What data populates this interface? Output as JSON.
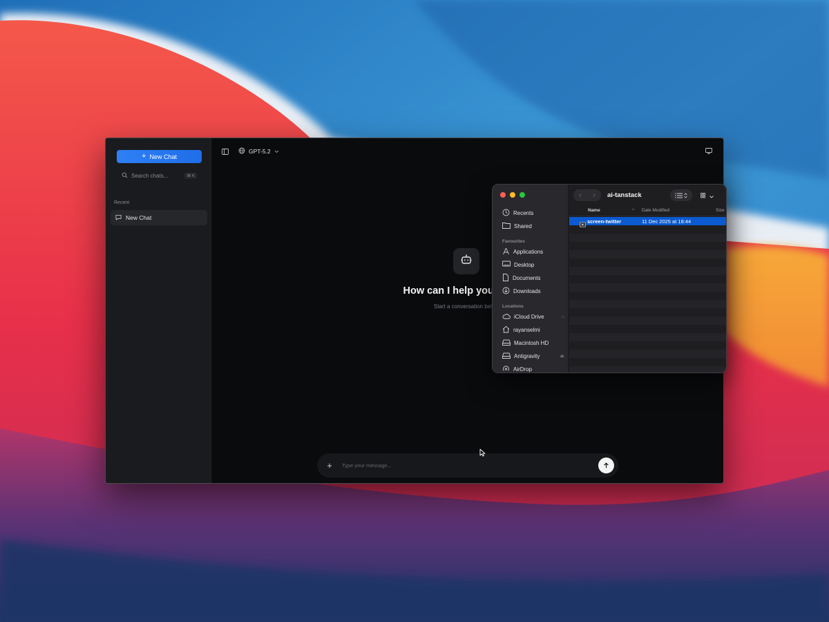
{
  "colors": {
    "accent": "#1f6ee8",
    "window_bg": "#0a0b0d",
    "sidebar_bg": "#1a1b1e",
    "selection": "#0b5acf"
  },
  "chat_app": {
    "sidebar": {
      "new_chat_label": "New Chat",
      "search_placeholder": "Search chats...",
      "search_shortcut": "⌘ K",
      "recent_label": "Recent",
      "history": [
        {
          "label": "New Chat",
          "icon": "chat-bubble-icon"
        }
      ]
    },
    "topbar": {
      "model": "GPT-5.2",
      "model_icon": "globe-icon"
    },
    "welcome": {
      "icon": "bot-icon",
      "title": "How can I help you today?",
      "subtitle": "Start a conversation below"
    },
    "composer": {
      "placeholder": "Type your message...",
      "attach_icon": "plus-icon",
      "send_icon": "arrow-up-icon"
    }
  },
  "finder": {
    "title": "ai-tanstack",
    "sidebar": {
      "top": [
        {
          "label": "Recents",
          "icon": "clock-icon"
        },
        {
          "label": "Shared",
          "icon": "shared-folder-icon"
        }
      ],
      "favourites_label": "Favourites",
      "favourites": [
        {
          "label": "Applications",
          "icon": "applications-icon"
        },
        {
          "label": "Desktop",
          "icon": "desktop-icon"
        },
        {
          "label": "Documents",
          "icon": "document-icon"
        },
        {
          "label": "Downloads",
          "icon": "download-icon"
        }
      ],
      "locations_label": "Locations",
      "locations": [
        {
          "label": "iCloud Drive",
          "icon": "cloud-icon"
        },
        {
          "label": "rayanselmi",
          "icon": "home-icon"
        },
        {
          "label": "Macintosh HD",
          "icon": "drive-icon"
        },
        {
          "label": "Antigravity",
          "icon": "drive-icon"
        },
        {
          "label": "AirDrop",
          "icon": "airdrop-icon"
        }
      ]
    },
    "columns": {
      "name": "Name",
      "date_modified": "Date Modified",
      "size": "Size"
    },
    "files": [
      {
        "name": "screen-twitter",
        "date_modified": "11 Dec 2025 at 18:44",
        "icon": "video-file-icon"
      }
    ]
  }
}
